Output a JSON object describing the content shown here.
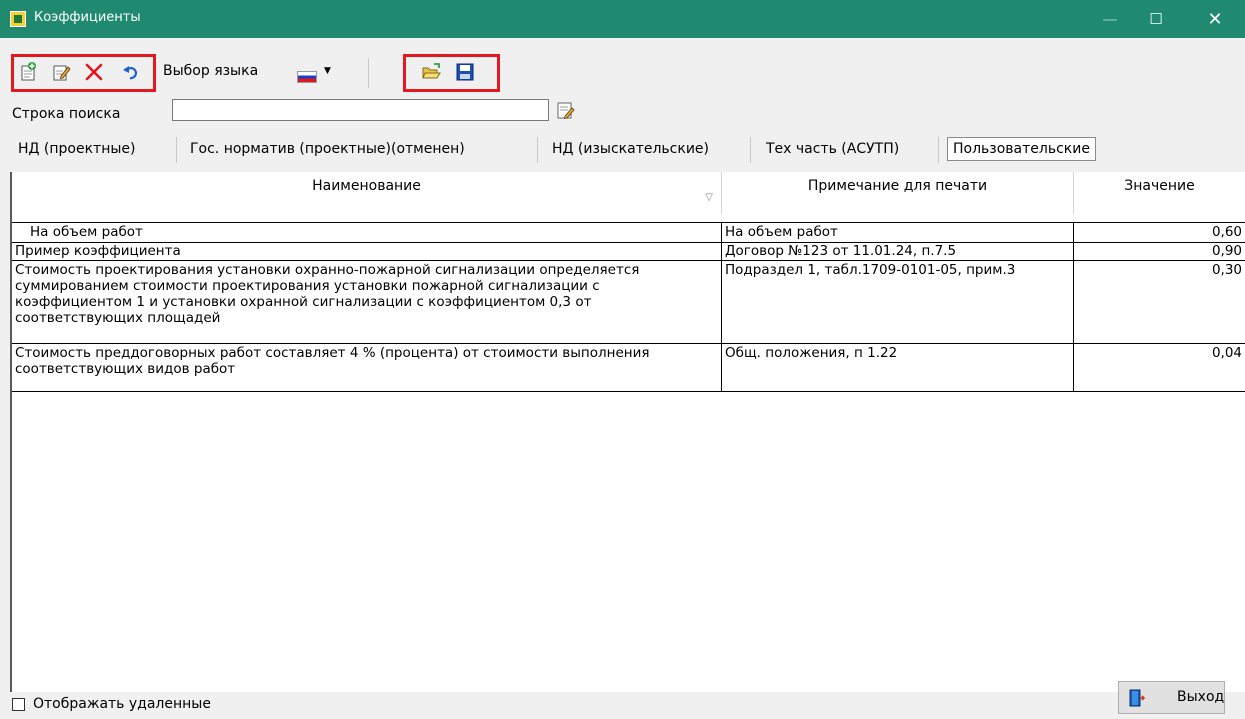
{
  "window": {
    "title": "Коэффициенты",
    "min_glyph": "—",
    "max_glyph": "☐",
    "close_glyph": "✕"
  },
  "toolbar": {
    "language_label": "Выбор языка",
    "flag_arrow": "▼",
    "icons": [
      "add-icon",
      "edit-icon",
      "delete-icon",
      "undo-icon",
      "language-flag-icon",
      "open-folder-icon",
      "save-icon"
    ]
  },
  "search": {
    "label": "Строка поиска",
    "value": "",
    "placeholder": ""
  },
  "tabs": [
    {
      "label": "НД (проектные)"
    },
    {
      "label": "Гос. норматив (проектные)(отменен)"
    },
    {
      "label": "НД (изыскательские)"
    },
    {
      "label": "Тех часть (АСУТП)"
    },
    {
      "label": "Пользовательские"
    }
  ],
  "active_tab": 4,
  "table": {
    "columns": [
      "Наименование",
      "Примечание для печати",
      "Значение"
    ],
    "sort_glyph": "▽",
    "rows": [
      {
        "name": "На объем работ",
        "note": "На объем работ",
        "value": "0,60"
      },
      {
        "name": "Пример коэффициента",
        "note": "Договор №123 от 11.01.24, п.7.5",
        "value": "0,90"
      },
      {
        "name": "Стоимость проектирования установки охранно-пожарной сигнализации определяется суммированием стоимости проектирования установки пожарной сигнализации с коэффициентом 1 и установки охранной сигнализации с коэффициентом 0,3 от соответствующих площадей",
        "note": "Подраздел 1, табл.1709-0101-05, прим.3",
        "value": "0,30"
      },
      {
        "name": "Стоимость преддоговорных работ составляет 4 % (процента) от стоимости выполнения соответствующих видов работ",
        "note": "Общ. положения, п 1.22",
        "value": "0,04"
      }
    ]
  },
  "footer": {
    "show_deleted_label": "Отображать удаленные",
    "show_deleted_checked": false,
    "exit_label": "Выход"
  },
  "colors": {
    "titlebar": "#1f8a70",
    "highlight": "#e4191f"
  }
}
